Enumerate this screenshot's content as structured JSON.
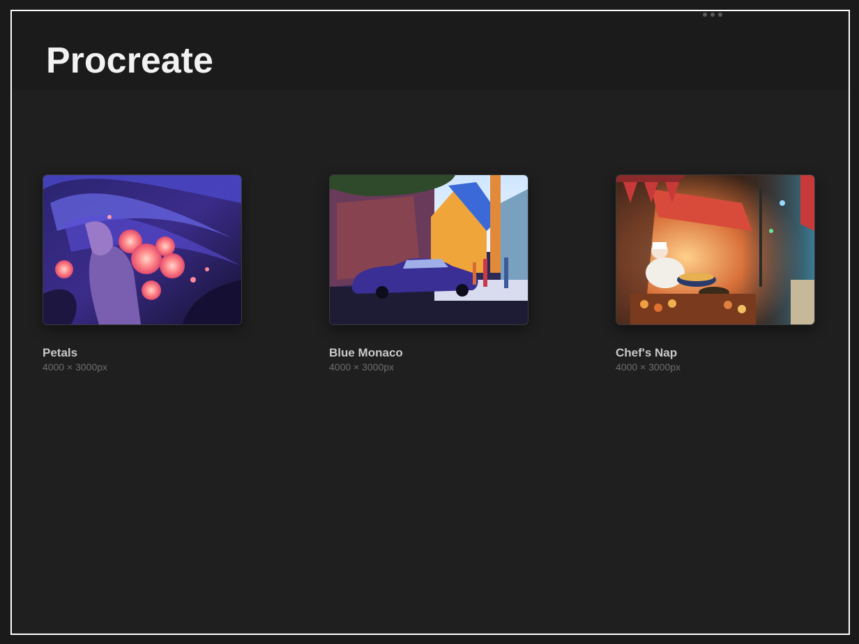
{
  "header": {
    "title": "Procreate",
    "more_icon": "ellipsis-icon"
  },
  "gallery": {
    "artworks": [
      {
        "name": "Petals",
        "size": "4000 × 3000px",
        "icon": "artwork-thumbnail"
      },
      {
        "name": "Blue Monaco",
        "size": "4000 × 3000px",
        "icon": "artwork-thumbnail"
      },
      {
        "name": "Chef's Nap",
        "size": "4000 × 3000px",
        "icon": "artwork-thumbnail"
      }
    ]
  },
  "colors": {
    "background": "#1f1f1f",
    "header_background": "#1b1b1b",
    "title": "#f2f2f2",
    "name_text": "#c9c9c9",
    "size_text": "#6e6e6e"
  }
}
